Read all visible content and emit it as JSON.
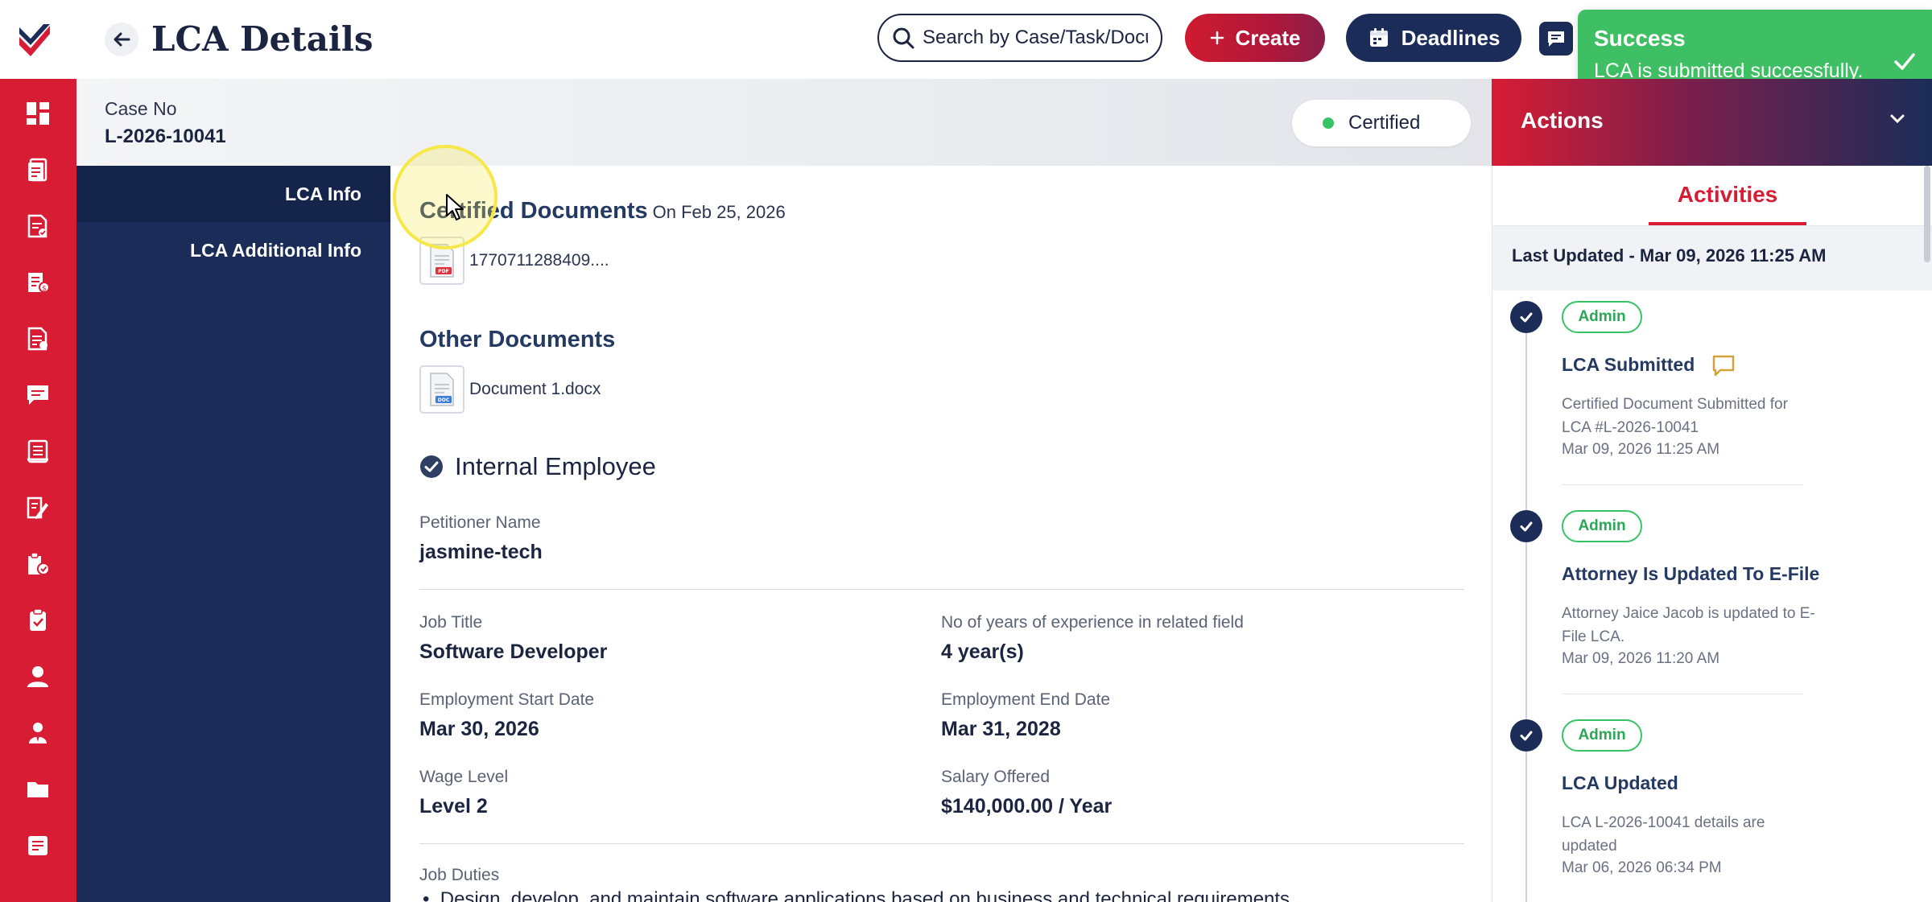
{
  "header": {
    "title": "LCA Details",
    "search_placeholder": "Search by Case/Task/Docu",
    "create_label": "Create",
    "deadlines_label": "Deadlines"
  },
  "toast": {
    "title": "Success",
    "message": "LCA is submitted successfully."
  },
  "case": {
    "label": "Case No",
    "number": "L-2026-10041",
    "status": "Certified"
  },
  "sidenav": {
    "items": [
      "LCA Info",
      "LCA Additional Info"
    ]
  },
  "main": {
    "certified": {
      "title": "Certified Documents",
      "date": "On Feb 25, 2026",
      "file": "1770711288409...."
    },
    "other": {
      "title": "Other Documents",
      "file": "Document 1.docx"
    },
    "employee_type": "Internal Employee",
    "petitioner_label": "Petitioner Name",
    "petitioner_value": "jasmine-tech",
    "job_title_label": "Job Title",
    "job_title_value": "Software Developer",
    "experience_label": "No of years of experience in related field",
    "experience_value": "4 year(s)",
    "start_label": "Employment Start Date",
    "start_value": "Mar 30, 2026",
    "end_label": "Employment End Date",
    "end_value": "Mar 31, 2028",
    "wage_label": "Wage Level",
    "wage_value": "Level 2",
    "salary_label": "Salary Offered",
    "salary_value": "$140,000.00 / Year",
    "duties_label": "Job Duties",
    "duty_1": "Design, develop, and maintain software applications based on business and technical requirements."
  },
  "actions": {
    "title": "Actions",
    "tab": "Activities",
    "last_updated": "Last Updated - Mar 09, 2026 11:25 AM",
    "items": [
      {
        "badge": "Admin",
        "title": "LCA Submitted",
        "desc": "Certified Document Submitted for LCA #L-2026-10041",
        "time": "Mar 09, 2026 11:25 AM"
      },
      {
        "badge": "Admin",
        "title": "Attorney Is Updated To E-File",
        "desc": "Attorney Jaice Jacob is updated to E-File LCA.",
        "time": "Mar 09, 2026 11:20 AM"
      },
      {
        "badge": "Admin",
        "title": "LCA Updated",
        "desc": "LCA L-2026-10041 details are updated",
        "time": "Mar 06, 2026 06:34 PM"
      }
    ]
  },
  "colors": {
    "brand_red": "#d81c34",
    "navy": "#1b2c58",
    "success_green": "#3fbf63",
    "status_green": "#35c466"
  }
}
